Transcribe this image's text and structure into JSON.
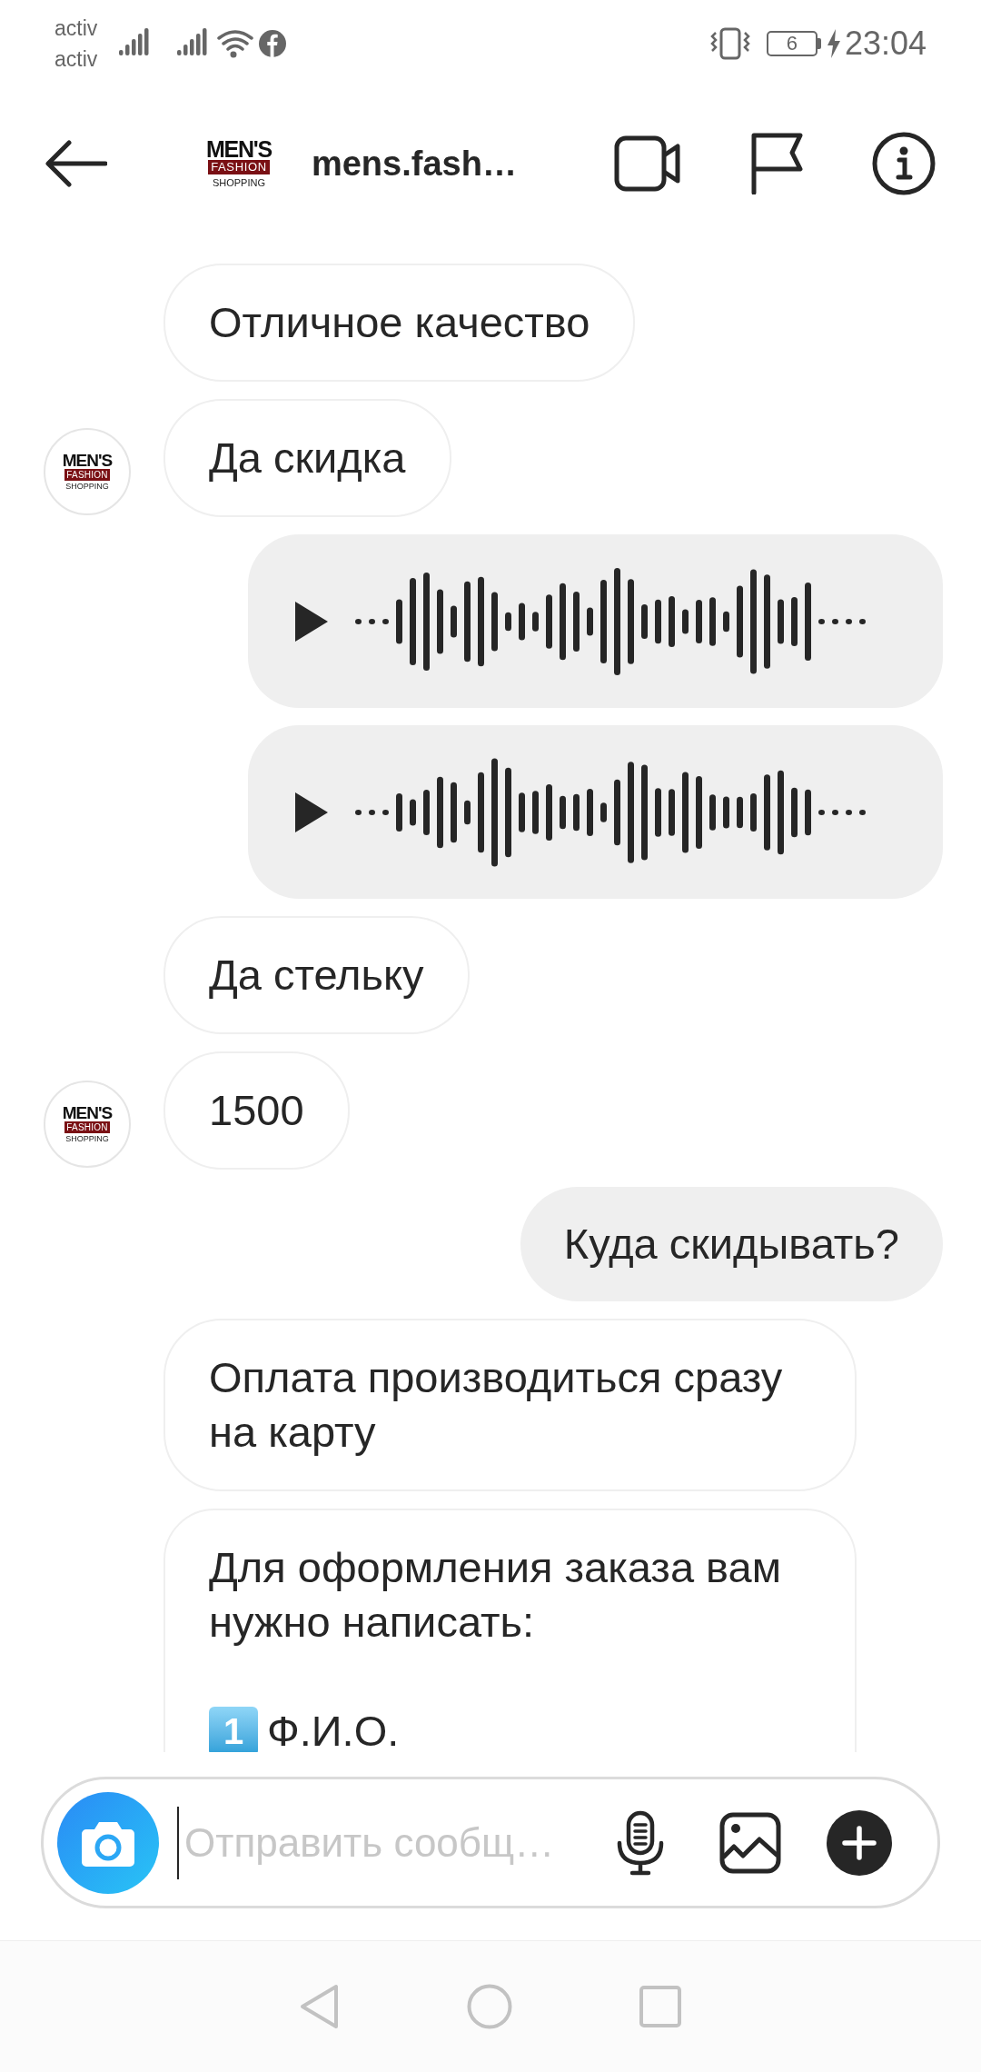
{
  "status_bar": {
    "carriers": [
      "activ",
      "activ"
    ],
    "battery": "6",
    "time": "23:04"
  },
  "header": {
    "logo": [
      "MEN'S",
      "FASHION",
      "SHOPPING"
    ],
    "username": "mens.fash…"
  },
  "messages": [
    {
      "kind": "text",
      "outgoing": false,
      "text": "Отличное качество"
    },
    {
      "kind": "text",
      "outgoing": false,
      "text": "Да скидка",
      "avatar": [
        "MEN'S",
        "FASHION",
        "SHOPPING"
      ]
    },
    {
      "kind": "voice",
      "outgoing": true
    },
    {
      "kind": "voice",
      "outgoing": true
    },
    {
      "kind": "text",
      "outgoing": false,
      "text": "Да стельку"
    },
    {
      "kind": "text",
      "outgoing": false,
      "text": "1500",
      "avatar": [
        "MEN'S",
        "FASHION",
        "SHOPPING"
      ]
    },
    {
      "kind": "text",
      "outgoing": true,
      "text": "Куда скидывать?"
    },
    {
      "kind": "text",
      "outgoing": false,
      "text": "Оплата производиться сразу на карту"
    },
    {
      "kind": "list",
      "outgoing": false,
      "text": "Для оформления заказа вам нужно написать:",
      "items": [
        {
          "number": "1",
          "text": "Ф.И.О."
        }
      ]
    }
  ],
  "composer": {
    "placeholder": "Отправить сообщ…"
  }
}
